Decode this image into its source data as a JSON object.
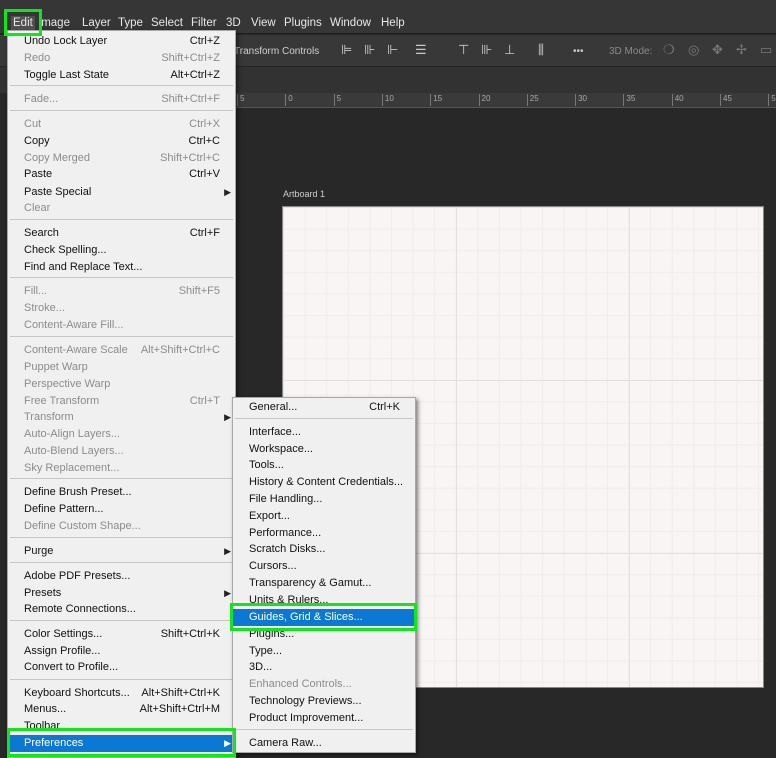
{
  "menubar": {
    "items": [
      "Edit",
      "Image",
      "Layer",
      "Type",
      "Select",
      "Filter",
      "3D",
      "View",
      "Plugins",
      "Window",
      "Help"
    ]
  },
  "options_bar": {
    "transform_label": "Transform Controls",
    "mode_label": "3D Mode:",
    "icons": [
      "align-left-icon",
      "align-center-icon",
      "align-right-icon",
      "distribute-icon",
      "align-top-icon",
      "align-middle-icon",
      "align-bottom-icon",
      "distribute-vertical-icon",
      "more-icon",
      "orbit-icon",
      "roll-icon",
      "pan-icon",
      "slide-icon",
      "scale-icon"
    ]
  },
  "ruler": {
    "ticks": [
      "5",
      "0",
      "5",
      "10",
      "15",
      "20",
      "25",
      "30",
      "35",
      "40",
      "45",
      "50"
    ]
  },
  "artboard": {
    "label": "Artboard 1"
  },
  "edit_menu": {
    "items": [
      {
        "label": "Undo Lock Layer",
        "shortcut": "Ctrl+Z",
        "disabled": false
      },
      {
        "label": "Redo",
        "shortcut": "Shift+Ctrl+Z",
        "disabled": true
      },
      {
        "label": "Toggle Last State",
        "shortcut": "Alt+Ctrl+Z",
        "disabled": false
      },
      {
        "label": "Fade...",
        "shortcut": "Shift+Ctrl+F",
        "disabled": true
      },
      {
        "label": "Cut",
        "shortcut": "Ctrl+X",
        "disabled": true
      },
      {
        "label": "Copy",
        "shortcut": "Ctrl+C",
        "disabled": false
      },
      {
        "label": "Copy Merged",
        "shortcut": "Shift+Ctrl+C",
        "disabled": true
      },
      {
        "label": "Paste",
        "shortcut": "Ctrl+V",
        "disabled": false
      },
      {
        "label": "Paste Special",
        "shortcut": "",
        "disabled": false,
        "submenu": true
      },
      {
        "label": "Clear",
        "shortcut": "",
        "disabled": true
      },
      {
        "label": "Search",
        "shortcut": "Ctrl+F",
        "disabled": false
      },
      {
        "label": "Check Spelling...",
        "shortcut": "",
        "disabled": false
      },
      {
        "label": "Find and Replace Text...",
        "shortcut": "",
        "disabled": false
      },
      {
        "label": "Fill...",
        "shortcut": "Shift+F5",
        "disabled": true
      },
      {
        "label": "Stroke...",
        "shortcut": "",
        "disabled": true
      },
      {
        "label": "Content-Aware Fill...",
        "shortcut": "",
        "disabled": true
      },
      {
        "label": "Content-Aware Scale",
        "shortcut": "Alt+Shift+Ctrl+C",
        "disabled": true
      },
      {
        "label": "Puppet Warp",
        "shortcut": "",
        "disabled": true
      },
      {
        "label": "Perspective Warp",
        "shortcut": "",
        "disabled": true
      },
      {
        "label": "Free Transform",
        "shortcut": "Ctrl+T",
        "disabled": true
      },
      {
        "label": "Transform",
        "shortcut": "",
        "disabled": true,
        "submenu": true
      },
      {
        "label": "Auto-Align Layers...",
        "shortcut": "",
        "disabled": true
      },
      {
        "label": "Auto-Blend Layers...",
        "shortcut": "",
        "disabled": true
      },
      {
        "label": "Sky Replacement...",
        "shortcut": "",
        "disabled": true
      },
      {
        "label": "Define Brush Preset...",
        "shortcut": "",
        "disabled": false
      },
      {
        "label": "Define Pattern...",
        "shortcut": "",
        "disabled": false
      },
      {
        "label": "Define Custom Shape...",
        "shortcut": "",
        "disabled": true
      },
      {
        "label": "Purge",
        "shortcut": "",
        "disabled": false,
        "submenu": true
      },
      {
        "label": "Adobe PDF Presets...",
        "shortcut": "",
        "disabled": false
      },
      {
        "label": "Presets",
        "shortcut": "",
        "disabled": false,
        "submenu": true
      },
      {
        "label": "Remote Connections...",
        "shortcut": "",
        "disabled": false
      },
      {
        "label": "Color Settings...",
        "shortcut": "Shift+Ctrl+K",
        "disabled": false
      },
      {
        "label": "Assign Profile...",
        "shortcut": "",
        "disabled": false
      },
      {
        "label": "Convert to Profile...",
        "shortcut": "",
        "disabled": false
      },
      {
        "label": "Keyboard Shortcuts...",
        "shortcut": "Alt+Shift+Ctrl+K",
        "disabled": false
      },
      {
        "label": "Menus...",
        "shortcut": "Alt+Shift+Ctrl+M",
        "disabled": false
      },
      {
        "label": "Toolbar...",
        "shortcut": "",
        "disabled": false
      },
      {
        "label": "Preferences",
        "shortcut": "",
        "disabled": false,
        "submenu": true,
        "highlighted": true
      }
    ]
  },
  "preferences_submenu": {
    "items": [
      {
        "label": "General...",
        "shortcut": "Ctrl+K",
        "disabled": false
      },
      {
        "label": "Interface...",
        "shortcut": "",
        "disabled": false
      },
      {
        "label": "Workspace...",
        "shortcut": "",
        "disabled": false
      },
      {
        "label": "Tools...",
        "shortcut": "",
        "disabled": false
      },
      {
        "label": "History & Content Credentials...",
        "shortcut": "",
        "disabled": false
      },
      {
        "label": "File Handling...",
        "shortcut": "",
        "disabled": false
      },
      {
        "label": "Export...",
        "shortcut": "",
        "disabled": false
      },
      {
        "label": "Performance...",
        "shortcut": "",
        "disabled": false
      },
      {
        "label": "Scratch Disks...",
        "shortcut": "",
        "disabled": false
      },
      {
        "label": "Cursors...",
        "shortcut": "",
        "disabled": false
      },
      {
        "label": "Transparency & Gamut...",
        "shortcut": "",
        "disabled": false
      },
      {
        "label": "Units & Rulers...",
        "shortcut": "",
        "disabled": false
      },
      {
        "label": "Guides, Grid & Slices...",
        "shortcut": "",
        "disabled": false,
        "highlighted": true
      },
      {
        "label": "Plugins...",
        "shortcut": "",
        "disabled": false
      },
      {
        "label": "Type...",
        "shortcut": "",
        "disabled": false
      },
      {
        "label": "3D...",
        "shortcut": "",
        "disabled": false
      },
      {
        "label": "Enhanced Controls...",
        "shortcut": "",
        "disabled": true
      },
      {
        "label": "Technology Previews...",
        "shortcut": "",
        "disabled": false
      },
      {
        "label": "Product Improvement...",
        "shortcut": "",
        "disabled": false
      },
      {
        "label": "Camera Raw...",
        "shortcut": "",
        "disabled": false
      }
    ]
  },
  "colors": {
    "highlight": "#0b78d4",
    "annotation": "#14e320",
    "menu_bg": "#f0f0f0",
    "app_bg": "#282828"
  }
}
